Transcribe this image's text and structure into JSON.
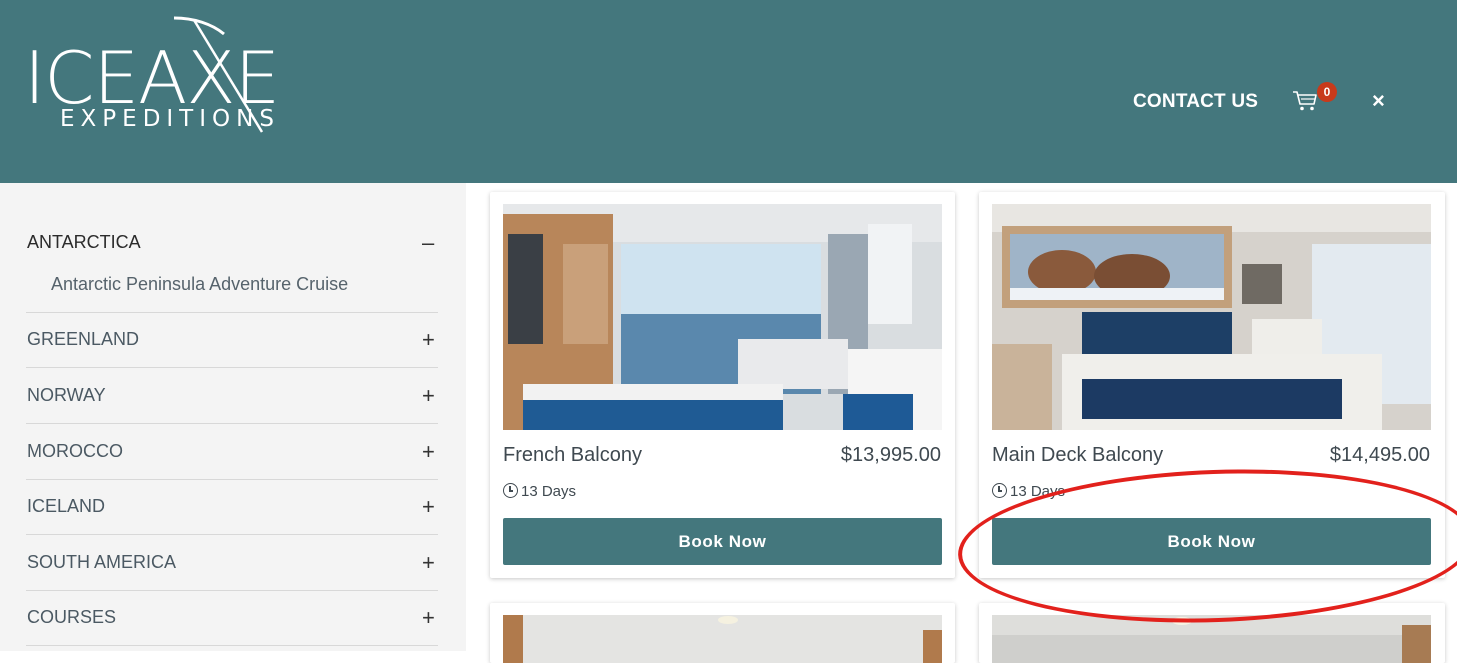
{
  "header": {
    "logo_main": "ICEAXE",
    "logo_sub": "EXPEDITIONS",
    "contact_label": "CONTACT US",
    "cart_count": "0",
    "close_label": "×"
  },
  "sidebar": {
    "categories": [
      {
        "label": "ANTARCTICA",
        "toggle": "–",
        "expanded": true,
        "children": [
          {
            "label": "Antarctic Peninsula Adventure Cruise"
          }
        ]
      },
      {
        "label": "GREENLAND",
        "toggle": "+"
      },
      {
        "label": "NORWAY",
        "toggle": "+"
      },
      {
        "label": "MOROCCO",
        "toggle": "+"
      },
      {
        "label": "ICELAND",
        "toggle": "+"
      },
      {
        "label": "SOUTH AMERICA",
        "toggle": "+"
      },
      {
        "label": "COURSES",
        "toggle": "+"
      }
    ]
  },
  "cabins": [
    {
      "name": "French Balcony",
      "price": "$13,995.00",
      "duration": "13 Days",
      "button": "Book Now"
    },
    {
      "name": "Main Deck Balcony",
      "price": "$14,495.00",
      "duration": "13 Days",
      "button": "Book Now"
    }
  ],
  "colors": {
    "brand": "#44777d",
    "badge": "#c83a1b",
    "annotation": "#e2211c"
  },
  "icons": [
    "ice-axe-logo-icon",
    "cart-icon",
    "close-icon",
    "clock-icon"
  ]
}
